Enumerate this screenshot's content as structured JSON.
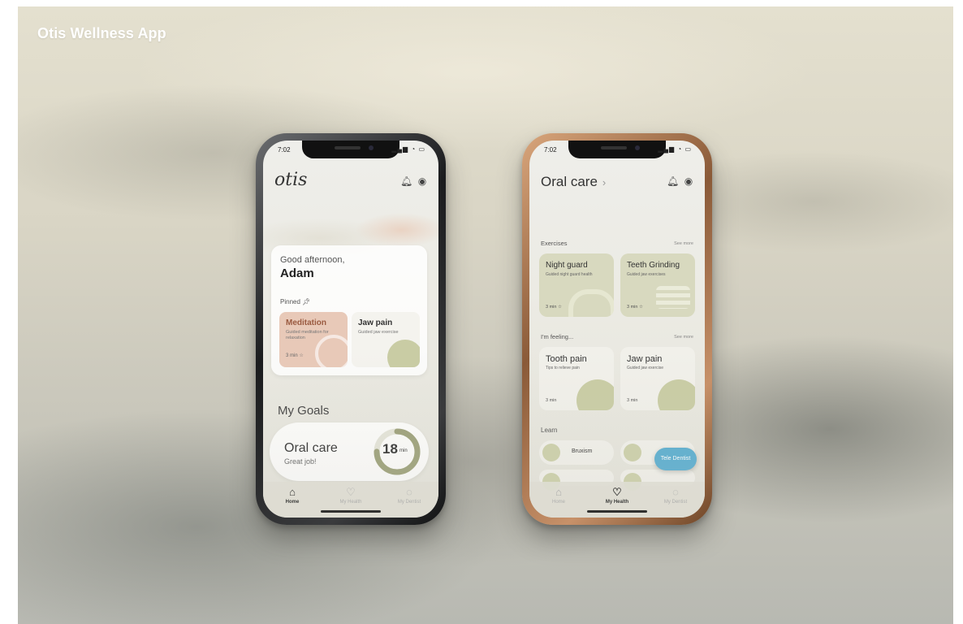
{
  "page": {
    "title": "Otis Wellness App"
  },
  "colors": {
    "accent_sage": "#c9cca4",
    "accent_peach": "#e8c9b8",
    "accent_blue": "#5aaed0"
  },
  "home": {
    "status_time": "7:02",
    "logo": "otis",
    "icons": [
      "bell-icon",
      "profile-icon"
    ],
    "greeting": "Good afternoon,",
    "user_name": "Adam",
    "pinned_label": "Pinned",
    "pinned": [
      {
        "title": "Meditation",
        "subtitle": "Guided meditation for relaxation",
        "duration": "3 min"
      },
      {
        "title": "Jaw pain",
        "subtitle": "Guided jaw exercise",
        "duration": ""
      }
    ],
    "goals_title": "My Goals",
    "goal": {
      "title": "Oral care",
      "subtitle": "Great job!",
      "value": "18",
      "unit": "min",
      "progress": 0.75
    },
    "tabs": [
      {
        "label": "Home",
        "icon": "home-icon",
        "active": true
      },
      {
        "label": "My Health",
        "icon": "heart-icon",
        "active": false
      },
      {
        "label": "My Dentist",
        "icon": "tooth-icon",
        "active": false
      }
    ]
  },
  "oral": {
    "status_time": "7:02",
    "title": "Oral care",
    "icons": [
      "bell-icon",
      "profile-icon"
    ],
    "exercises_label": "Exercises",
    "see_more": "See more",
    "exercises": [
      {
        "title": "Night guard",
        "subtitle": "Guided night guard health",
        "duration": "3 min"
      },
      {
        "title": "Teeth Grinding",
        "subtitle": "Guided jaw exercises",
        "duration": "3 min"
      }
    ],
    "feeling_label": "I'm feeling...",
    "feeling": [
      {
        "title": "Tooth pain",
        "subtitle": "Tips to relieve pain",
        "duration": "3 min"
      },
      {
        "title": "Jaw pain",
        "subtitle": "Guided jaw exercise",
        "duration": "3 min"
      }
    ],
    "learn_label": "Learn",
    "learn": [
      {
        "label": "Bruxism"
      }
    ],
    "fab_label": "Tele Dentist",
    "tabs": [
      {
        "label": "Home",
        "icon": "home-icon",
        "active": false
      },
      {
        "label": "My Health",
        "icon": "heart-icon",
        "active": true
      },
      {
        "label": "My Dentist",
        "icon": "tooth-icon",
        "active": false
      }
    ]
  }
}
